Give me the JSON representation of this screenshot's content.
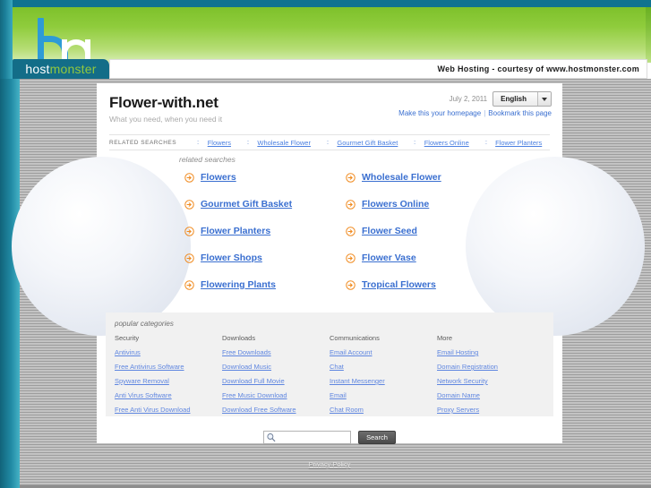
{
  "banner": {
    "logo": {
      "host": "host",
      "monster": "monster"
    },
    "courtesy_text": "Web Hosting - courtesy of www.hostmonster.com"
  },
  "header": {
    "site_title": "Flower-with.net",
    "tagline": "What you need, when you need it",
    "date": "July 2, 2011",
    "language": "English",
    "homepage_link": "Make this your homepage",
    "separator": "|",
    "bookmark_link": "Bookmark this page"
  },
  "related_nav": {
    "label": "RELATED SEARCHES",
    "dots": "::",
    "items": [
      {
        "label": "Flowers"
      },
      {
        "label": "Wholesale Flower"
      },
      {
        "label": "Gourmet Gift Basket"
      },
      {
        "label": "Flowers Online"
      },
      {
        "label": "Flower Planters"
      }
    ]
  },
  "related_searches": {
    "title": "related searches",
    "links": [
      {
        "label": "Flowers"
      },
      {
        "label": "Wholesale Flower"
      },
      {
        "label": "Gourmet Gift Basket"
      },
      {
        "label": "Flowers Online"
      },
      {
        "label": "Flower Planters"
      },
      {
        "label": "Flower Seed"
      },
      {
        "label": "Flower Shops"
      },
      {
        "label": "Flower Vase"
      },
      {
        "label": "Flowering Plants"
      },
      {
        "label": "Tropical Flowers"
      }
    ]
  },
  "popular_categories": {
    "title": "popular categories",
    "columns": [
      {
        "heading": "Security",
        "links": [
          "Antivirus",
          "Free Antivirus Software",
          "Spyware Removal",
          "Anti Virus Software",
          "Free Anti Virus Download"
        ]
      },
      {
        "heading": "Downloads",
        "links": [
          "Free Downloads",
          "Download Music",
          "Download Full Movie",
          "Free Music Download",
          "Download Free Software"
        ]
      },
      {
        "heading": "Communications",
        "links": [
          "Email Account",
          "Chat",
          "Instant Messenger",
          "Email",
          "Chat Room"
        ]
      },
      {
        "heading": "More",
        "links": [
          "Email Hosting",
          "Domain Registration",
          "Network Security",
          "Domain Name",
          "Proxy Servers"
        ]
      }
    ]
  },
  "search": {
    "value": "",
    "placeholder": "",
    "button_label": "Search"
  },
  "footer": {
    "privacy_label": "Privacy Policy"
  },
  "colors": {
    "teal": "#136d88",
    "green": "#92c83e",
    "link_blue": "#3a6fd0",
    "bullet_orange": "#f08a1e",
    "panel_gray": "#f1f1f1"
  }
}
